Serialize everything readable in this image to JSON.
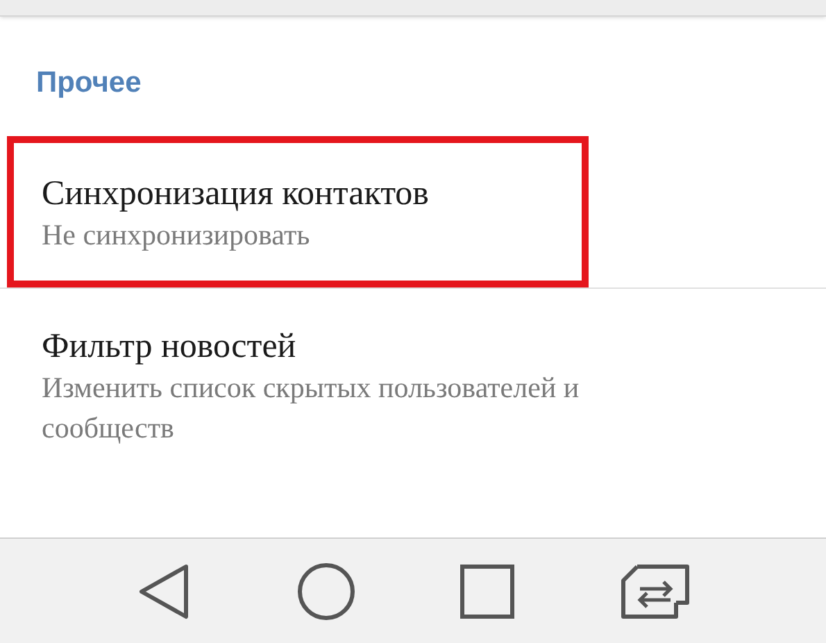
{
  "section": {
    "title": "Прочее"
  },
  "items": [
    {
      "title": "Синхронизация контактов",
      "subtitle": "Не синхронизировать",
      "highlighted": true
    },
    {
      "title": "Фильтр новостей",
      "subtitle": "Изменить список скрытых пользователей и сообществ",
      "highlighted": false
    }
  ],
  "nav_bar": [
    {
      "kind": "back"
    },
    {
      "kind": "home"
    },
    {
      "kind": "recents"
    },
    {
      "kind": "switch"
    }
  ]
}
